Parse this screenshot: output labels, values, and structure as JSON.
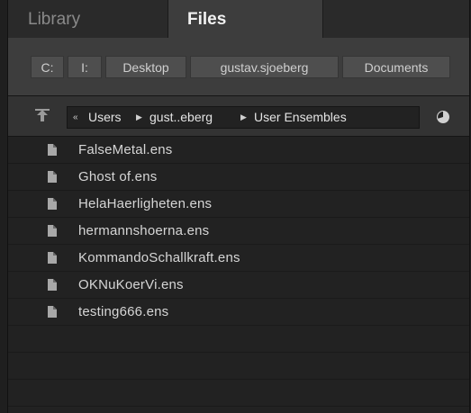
{
  "tabs": [
    {
      "label": "Library",
      "active": false
    },
    {
      "label": "Files",
      "active": true
    }
  ],
  "favorites": [
    "C:",
    "I:",
    "Desktop",
    "gustav.sjoeberg",
    "Documents"
  ],
  "path": {
    "back_symbol": "«",
    "segments": [
      "Users",
      "gust..eberg",
      "User Ensembles"
    ]
  },
  "files": [
    "FalseMetal.ens",
    "Ghost of.ens",
    "HelaHaerligheten.ens",
    "hermannshoerna.ens",
    "KommandoSchallkraft.ens",
    "OKNuKoerVi.ens",
    "testing666.ens"
  ],
  "icons": {
    "up": "arrow-up-icon",
    "history": "history-icon",
    "file": "file-icon"
  },
  "colors": {
    "background": "#222222",
    "active_tab": "#3d3d3d",
    "text": "#d6d6d6"
  }
}
